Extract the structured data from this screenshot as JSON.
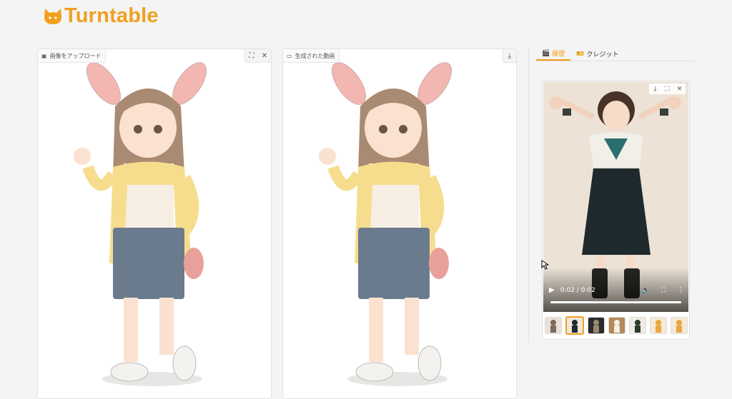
{
  "app": {
    "title": "Turntable",
    "logo_icon": "cat-head-icon",
    "accent": "#f0a020"
  },
  "upload_panel": {
    "label": "画像をアップロード",
    "icon": "image-icon",
    "buttons": [
      {
        "name": "fullscreen-icon",
        "glyph": "⛶"
      },
      {
        "name": "close-icon",
        "glyph": "✕"
      }
    ]
  },
  "output_panel": {
    "label": "生成された動画",
    "icon": "video-icon",
    "buttons": [
      {
        "name": "download-icon",
        "glyph": "⤓"
      }
    ]
  },
  "tabs": [
    {
      "label": "履歴",
      "icon": "clapper-icon",
      "active": true
    },
    {
      "label": "クレジット",
      "icon": "ticket-icon",
      "active": false
    }
  ],
  "video_player": {
    "time": "0:02 / 0:02",
    "progress_fraction": 1.0,
    "toolbar": [
      "download-icon",
      "fullscreen-icon",
      "close-icon"
    ]
  },
  "thumbnails": [
    {
      "name": "history-thumb-1"
    },
    {
      "name": "history-thumb-2",
      "selected": true
    },
    {
      "name": "history-thumb-3"
    },
    {
      "name": "history-thumb-4"
    },
    {
      "name": "history-thumb-5"
    },
    {
      "name": "history-thumb-6"
    },
    {
      "name": "history-thumb-7"
    },
    {
      "name": "history-thumb-8"
    }
  ]
}
